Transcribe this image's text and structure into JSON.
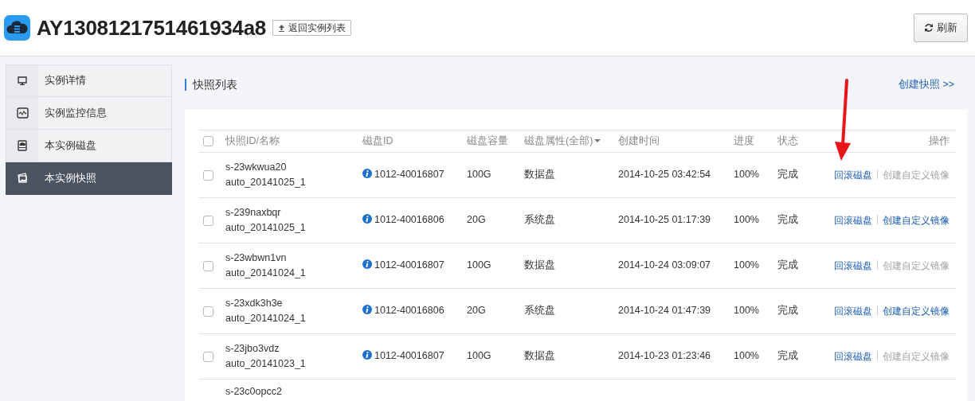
{
  "header": {
    "title": "AY1308121751461934a8",
    "back_button": "返回实例列表",
    "refresh_button": "刷新"
  },
  "sidebar": {
    "items": [
      {
        "label": "实例详情",
        "selected": false
      },
      {
        "label": "实例监控信息",
        "selected": false
      },
      {
        "label": "本实例磁盘",
        "selected": false
      },
      {
        "label": "本实例快照",
        "selected": true
      }
    ]
  },
  "section": {
    "title": "快照列表",
    "create_link": "创建快照 >>"
  },
  "table": {
    "select_all": {
      "checked": false
    },
    "columns": [
      {
        "label": "快照ID/名称"
      },
      {
        "label": "磁盘ID"
      },
      {
        "label": "磁盘容量"
      },
      {
        "label": "磁盘属性(全部)",
        "dropdown": true
      },
      {
        "label": "创建时间"
      },
      {
        "label": "进度"
      },
      {
        "label": "状态"
      },
      {
        "label": "操作"
      }
    ],
    "rows": [
      {
        "checked": false,
        "snapshot_id": "s-23wkwua20",
        "name": "auto_20141025_1",
        "disk_id": "1012-40016807",
        "capacity": "100G",
        "disk_type": "数据盘",
        "created": "2014-10-25 03:42:54",
        "progress": "100%",
        "status": "完成",
        "actions": [
          {
            "label": "回滚磁盘",
            "disabled": false
          },
          {
            "label": "创建自定义镜像",
            "disabled": true
          }
        ]
      },
      {
        "checked": false,
        "snapshot_id": "s-239naxbqr",
        "name": "auto_20141025_1",
        "disk_id": "1012-40016806",
        "capacity": "20G",
        "disk_type": "系统盘",
        "created": "2014-10-25 01:17:39",
        "progress": "100%",
        "status": "完成",
        "actions": [
          {
            "label": "回滚磁盘",
            "disabled": false
          },
          {
            "label": "创建自定义镜像",
            "disabled": false
          }
        ]
      },
      {
        "checked": false,
        "snapshot_id": "s-23wbwn1vn",
        "name": "auto_20141024_1",
        "disk_id": "1012-40016807",
        "capacity": "100G",
        "disk_type": "数据盘",
        "created": "2014-10-24 03:09:07",
        "progress": "100%",
        "status": "完成",
        "actions": [
          {
            "label": "回滚磁盘",
            "disabled": false
          },
          {
            "label": "创建自定义镜像",
            "disabled": true
          }
        ]
      },
      {
        "checked": false,
        "snapshot_id": "s-23xdk3h3e",
        "name": "auto_20141024_1",
        "disk_id": "1012-40016806",
        "capacity": "20G",
        "disk_type": "系统盘",
        "created": "2014-10-24 01:47:39",
        "progress": "100%",
        "status": "完成",
        "actions": [
          {
            "label": "回滚磁盘",
            "disabled": false
          },
          {
            "label": "创建自定义镜像",
            "disabled": false
          }
        ]
      },
      {
        "checked": false,
        "snapshot_id": "s-23jbo3vdz",
        "name": "auto_20141023_1",
        "disk_id": "1012-40016807",
        "capacity": "100G",
        "disk_type": "数据盘",
        "created": "2014-10-23 01:23:46",
        "progress": "100%",
        "status": "完成",
        "actions": [
          {
            "label": "回滚磁盘",
            "disabled": false
          },
          {
            "label": "创建自定义镜像",
            "disabled": true
          }
        ]
      },
      {
        "snapshot_id": "s-23c0opcc2"
      }
    ]
  }
}
